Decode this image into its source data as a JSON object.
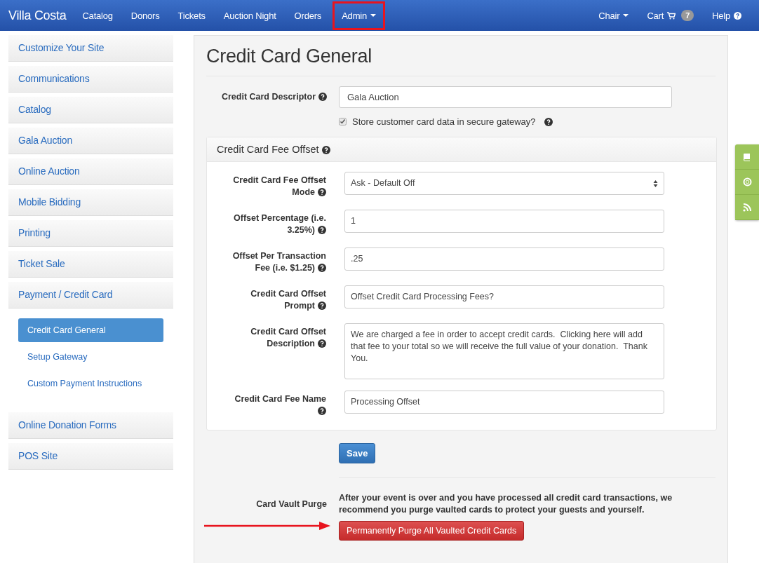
{
  "navbar": {
    "brand": "Villa Costa",
    "items": [
      {
        "label": "Catalog",
        "dropdown": false,
        "highlighted": false
      },
      {
        "label": "Donors",
        "dropdown": false,
        "highlighted": false
      },
      {
        "label": "Tickets",
        "dropdown": false,
        "highlighted": false
      },
      {
        "label": "Auction Night",
        "dropdown": false,
        "highlighted": false
      },
      {
        "label": "Orders",
        "dropdown": false,
        "highlighted": false
      },
      {
        "label": "Admin",
        "dropdown": true,
        "highlighted": true
      }
    ],
    "right": [
      {
        "kind": "dropdown",
        "label": "Chair"
      },
      {
        "kind": "cart",
        "label": "Cart",
        "badge": "7"
      },
      {
        "kind": "help",
        "label": "Help"
      }
    ]
  },
  "sidebar": {
    "items": [
      {
        "label": "Customize Your Site"
      },
      {
        "label": "Communications"
      },
      {
        "label": "Catalog"
      },
      {
        "label": "Gala Auction"
      },
      {
        "label": "Online Auction"
      },
      {
        "label": "Mobile Bidding"
      },
      {
        "label": "Printing"
      },
      {
        "label": "Ticket Sale"
      },
      {
        "label": "Payment / Credit Card",
        "children": [
          {
            "label": "Credit Card General",
            "selected": true
          },
          {
            "label": "Setup Gateway",
            "selected": false
          },
          {
            "label": "Custom Payment Instructions",
            "selected": false
          }
        ]
      },
      {
        "label": "Online Donation Forms"
      },
      {
        "label": "POS Site"
      }
    ]
  },
  "page": {
    "title": "Credit Card General",
    "descriptor": {
      "label": "Credit Card Descriptor",
      "value": "Gala Auction"
    },
    "store_card": {
      "label": "Store customer card data in secure gateway?",
      "checked": true
    },
    "fee_offset": {
      "title": "Credit Card Fee Offset",
      "fields": [
        {
          "kind": "select",
          "label": "Credit Card Fee Offset Mode",
          "value": "Ask - Default Off"
        },
        {
          "kind": "input",
          "label": "Offset Percentage (i.e. 3.25%)",
          "value": "1"
        },
        {
          "kind": "input",
          "label": "Offset Per Transaction Fee (i.e. $1.25)",
          "value": ".25"
        },
        {
          "kind": "input",
          "label": "Credit Card Offset Prompt",
          "value": "Offset Credit Card Processing Fees?"
        },
        {
          "kind": "textarea",
          "label": "Credit Card Offset Description",
          "value": "We are charged a fee in order to accept credit cards.  Clicking here will add that fee to your total so we will receive the full value of your donation.  Thank You."
        },
        {
          "kind": "input",
          "label": "Credit Card Fee Name",
          "value": "Processing Offset"
        }
      ]
    },
    "save": "Save",
    "purge": {
      "label": "Card Vault Purge",
      "text": "After your event is over and you have processed all credit card transactions, we recommend you purge vaulted cards to protect your guests and yourself.",
      "button": "Permanently Purge All Vaulted Credit Cards"
    }
  },
  "side_tools": [
    {
      "kind": "book"
    },
    {
      "kind": "lifebuoy"
    },
    {
      "kind": "rss"
    }
  ]
}
